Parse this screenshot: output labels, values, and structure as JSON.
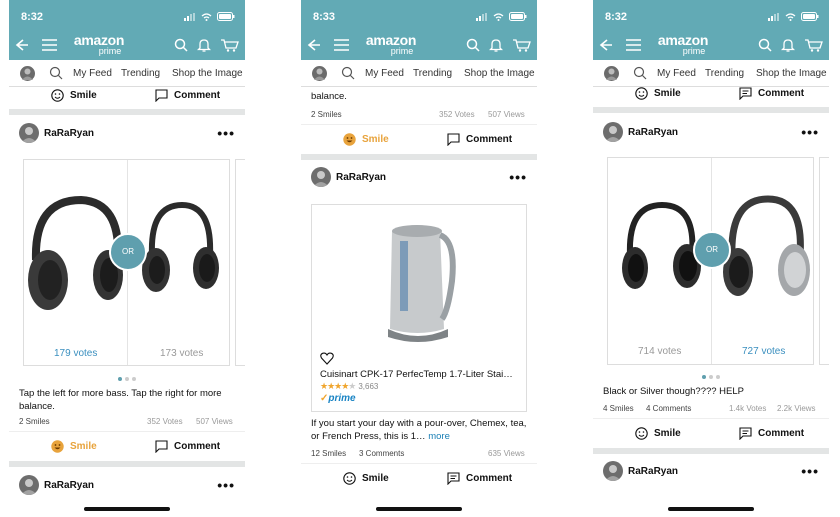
{
  "status": {
    "time": "8:32",
    "time2": "8:33"
  },
  "nav": {
    "logo_amazon": "amazon",
    "logo_prime": "prime"
  },
  "tabs": {
    "feed": "My Feed",
    "trending": "Trending",
    "shop": "Shop the Image"
  },
  "actions": {
    "smile": "Smile",
    "comment": "Comment",
    "more": "more"
  },
  "user": "RaRaRyan",
  "screen1": {
    "vote_left": "179 votes",
    "vote_right": "173 votes",
    "caption": "Tap the left for more bass. Tap the right for more balance.",
    "smiles": "2 Smiles",
    "votes_total": "352 Votes",
    "views": "507 Views"
  },
  "screen2": {
    "top_caption_tail": "balance.",
    "top_smiles": "2 Smiles",
    "top_votes": "352 Votes",
    "top_views": "507 Views",
    "product_name": "Cuisinart CPK-17 PerfecTemp 1.7-Liter Stai…",
    "rating_count": "3,663",
    "prime_label": "prime",
    "caption": "If you start your day with a pour-over, Chemex, tea, or French Press, this is 1…",
    "smiles": "12 Smiles",
    "comments": "3 Comments",
    "views": "635 Views"
  },
  "screen3": {
    "vote_left": "714 votes",
    "vote_right": "727 votes",
    "caption": "Black or Silver though???? HELP",
    "smiles": "4 Smiles",
    "comments": "4 Comments",
    "votes_total": "1.4k Votes",
    "views": "2.2k Views"
  },
  "colors": {
    "brand": "#62aab5",
    "or_badge": "#5f9fae",
    "smile_active": "#e8a33c",
    "vote_link": "#3a8fbf"
  },
  "icons": [
    "back-icon",
    "menu-icon",
    "search-icon",
    "bell-icon",
    "cart-icon",
    "smile-icon",
    "comment-icon",
    "heart-icon",
    "star-icon"
  ]
}
